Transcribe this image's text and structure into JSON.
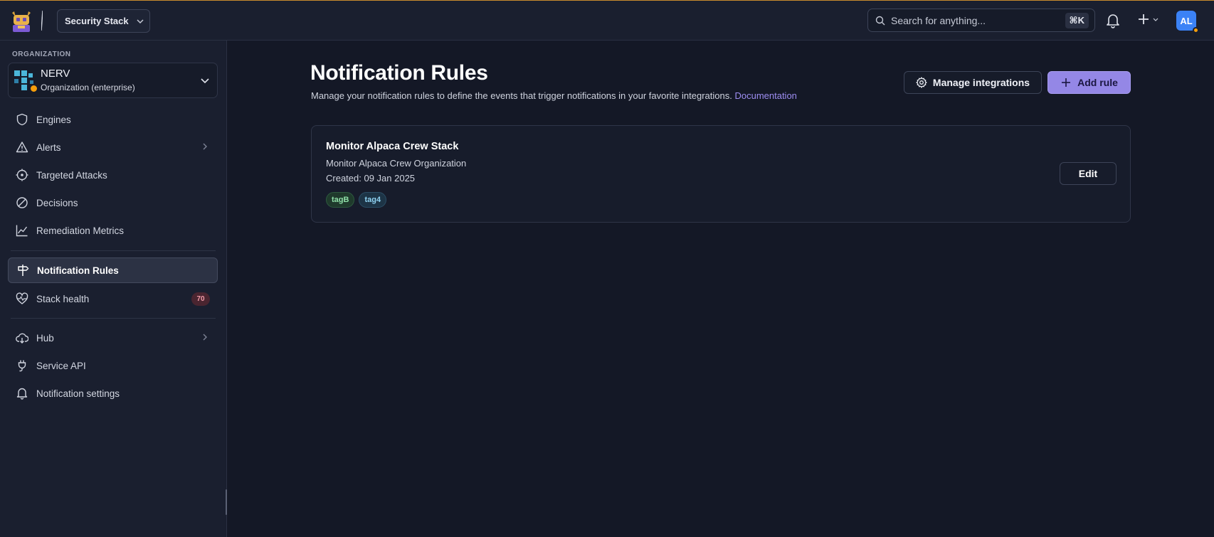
{
  "header": {
    "stack_name": "Security Stack",
    "search_placeholder": "Search for anything...",
    "search_shortcut": "⌘K",
    "avatar_initials": "AL"
  },
  "sidebar": {
    "org_section_label": "ORGANIZATION",
    "org_name": "NERV",
    "org_type": "Organization (enterprise)",
    "items": [
      {
        "label": "Engines",
        "icon": "shield-icon"
      },
      {
        "label": "Alerts",
        "icon": "warning-triangle-icon"
      },
      {
        "label": "Targeted Attacks",
        "icon": "target-icon"
      },
      {
        "label": "Decisions",
        "icon": "prohibited-icon"
      },
      {
        "label": "Remediation Metrics",
        "icon": "line-chart-icon"
      },
      {
        "label": "Notification Rules",
        "icon": "signpost-icon",
        "active": true
      },
      {
        "label": "Stack health",
        "icon": "heart-pulse-icon",
        "badge": "70"
      },
      {
        "label": "Hub",
        "icon": "cloud-download-icon"
      },
      {
        "label": "Service API",
        "icon": "plug-icon"
      },
      {
        "label": "Notification settings",
        "icon": "bell-icon"
      }
    ]
  },
  "main": {
    "title": "Notification Rules",
    "description": "Manage your notification rules to define the events that trigger notifications in your favorite integrations.",
    "doc_link": "Documentation",
    "manage_integrations_label": "Manage integrations",
    "add_rule_label": "Add rule",
    "rules": [
      {
        "title": "Monitor Alpaca Crew Stack",
        "organization": "Monitor Alpaca Crew Organization",
        "created": "Created: 09 Jan 2025",
        "tags": [
          "tagB",
          "tag4"
        ],
        "edit_label": "Edit"
      }
    ]
  },
  "colors": {
    "background": "#141826",
    "accent": "#9487e6",
    "link": "#9d8df1",
    "warning_dot": "#f59e0b"
  }
}
